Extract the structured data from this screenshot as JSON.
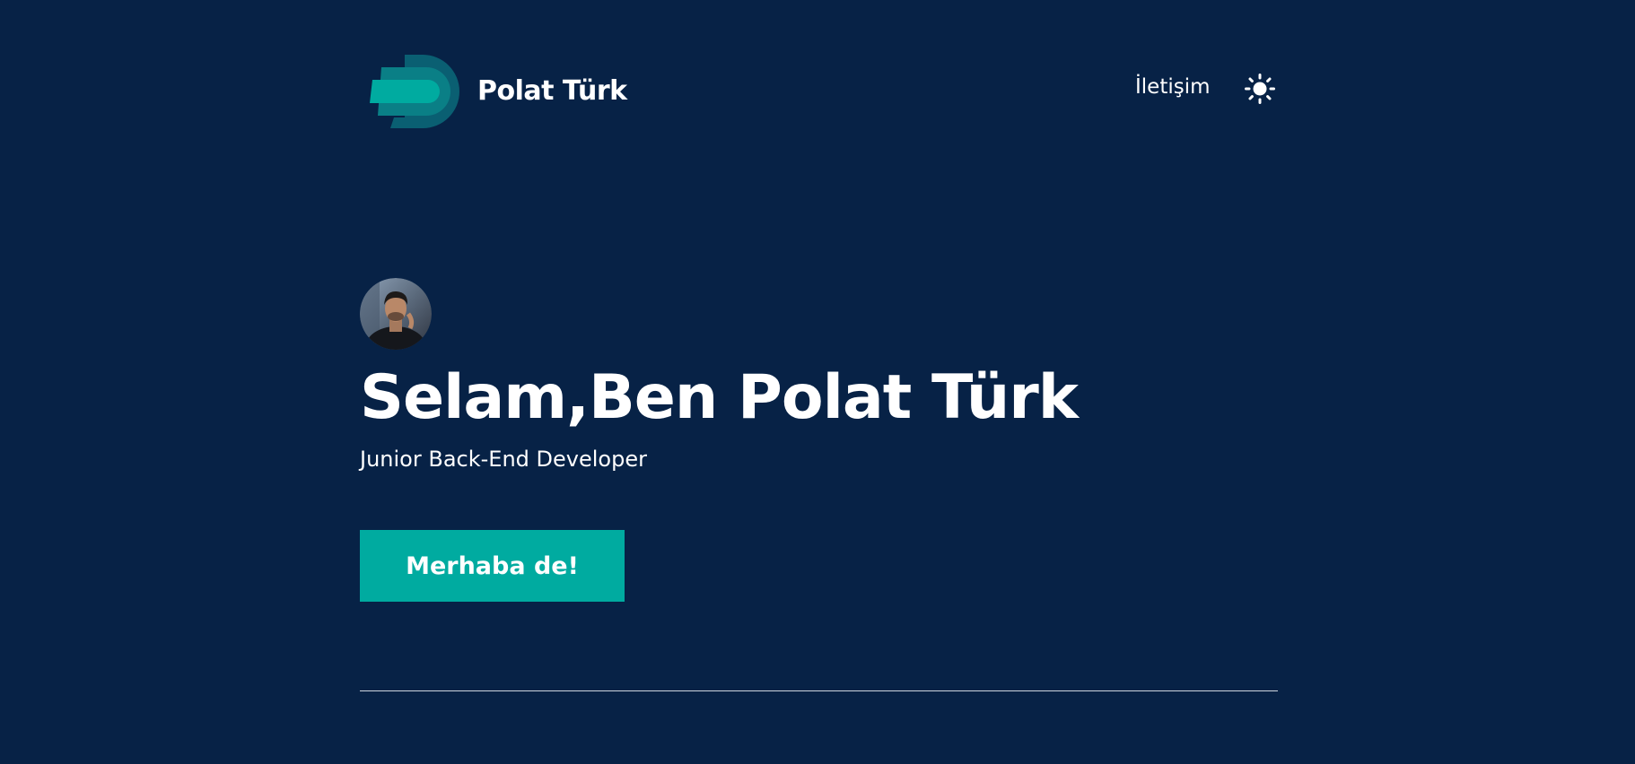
{
  "header": {
    "brand_name": "Polat Türk",
    "nav_contact": "İletişim",
    "logo_icon": "d-logo-icon",
    "theme_icon": "sun-icon"
  },
  "hero": {
    "avatar_icon": "profile-photo",
    "title": "Selam,Ben Polat Türk",
    "subtitle": "Junior Back-End Developer",
    "cta_label": "Merhaba de!"
  },
  "colors": {
    "background": "#072246",
    "accent": "#00aba0",
    "logo_dark": "#0a5f72",
    "logo_light": "#00aba0",
    "text": "#ffffff"
  }
}
